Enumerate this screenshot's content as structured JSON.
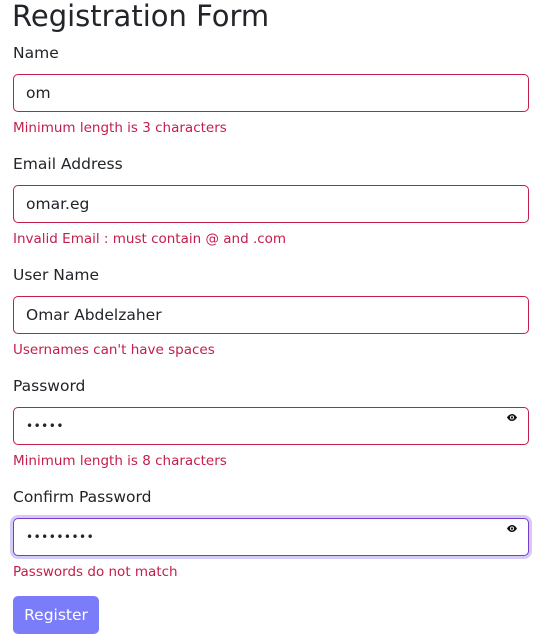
{
  "form": {
    "title": "Registration Form",
    "fields": [
      {
        "label": "Name",
        "value": "om",
        "error": "Minimum length is 3 characters"
      },
      {
        "label": "Email Address",
        "value": "omar.eg",
        "error": "Invalid Email : must contain @ and .com"
      },
      {
        "label": "User Name",
        "value": "Omar Abdelzaher",
        "error": "Usernames can't have spaces"
      },
      {
        "label": "Password",
        "value": "•••••",
        "error": "Minimum length is 8 characters"
      },
      {
        "label": "Confirm Password",
        "value": "•••••••••",
        "error": "Passwords do not match"
      }
    ],
    "submit_label": "Register"
  },
  "icons": {
    "password_toggle": "eye-icon"
  },
  "colors": {
    "error": "#c51d4b",
    "focus": "#7b3bd1",
    "button": "#7a7cfa",
    "text": "#212529"
  }
}
